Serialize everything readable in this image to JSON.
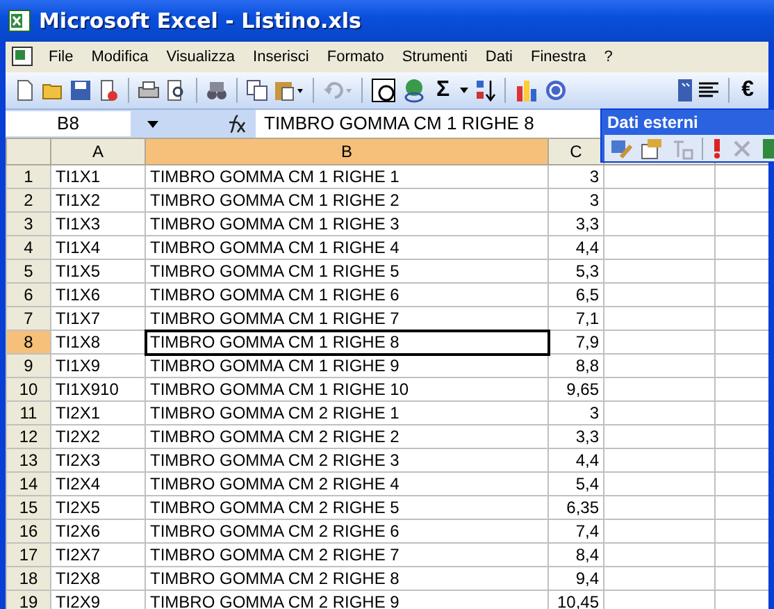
{
  "window": {
    "title": "Microsoft Excel - Listino.xls"
  },
  "menu": [
    "File",
    "Modifica",
    "Visualizza",
    "Inserisci",
    "Formato",
    "Strumenti",
    "Dati",
    "Finestra",
    "?"
  ],
  "toolbar": {
    "sum_symbol": "Σ",
    "euro_symbol": "€"
  },
  "formula_bar": {
    "name_box": "B8",
    "value": "TIMBRO GOMMA CM 1 RIGHE 8"
  },
  "floating_toolbar": {
    "title": "Dati esterni"
  },
  "columns": [
    {
      "label": "A",
      "selected": false
    },
    {
      "label": "B",
      "selected": true
    },
    {
      "label": "C",
      "selected": false
    }
  ],
  "rows": [
    {
      "num": "1",
      "a": "TI1X1",
      "b": "TIMBRO GOMMA CM 1 RIGHE 1",
      "c": "3",
      "selected": false
    },
    {
      "num": "2",
      "a": "TI1X2",
      "b": "TIMBRO GOMMA CM 1 RIGHE 2",
      "c": "3",
      "selected": false
    },
    {
      "num": "3",
      "a": "TI1X3",
      "b": "TIMBRO GOMMA CM 1 RIGHE 3",
      "c": "3,3",
      "selected": false
    },
    {
      "num": "4",
      "a": "TI1X4",
      "b": "TIMBRO GOMMA CM 1 RIGHE 4",
      "c": "4,4",
      "selected": false
    },
    {
      "num": "5",
      "a": "TI1X5",
      "b": "TIMBRO GOMMA CM 1 RIGHE 5",
      "c": "5,3",
      "selected": false
    },
    {
      "num": "6",
      "a": "TI1X6",
      "b": "TIMBRO GOMMA CM 1 RIGHE 6",
      "c": "6,5",
      "selected": false
    },
    {
      "num": "7",
      "a": "TI1X7",
      "b": "TIMBRO GOMMA CM 1 RIGHE 7",
      "c": "7,1",
      "selected": false
    },
    {
      "num": "8",
      "a": "TI1X8",
      "b": "TIMBRO GOMMA CM 1 RIGHE 8",
      "c": "7,9",
      "selected": true
    },
    {
      "num": "9",
      "a": "TI1X9",
      "b": "TIMBRO GOMMA CM 1 RIGHE 9",
      "c": "8,8",
      "selected": false
    },
    {
      "num": "10",
      "a": "TI1X910",
      "b": "TIMBRO GOMMA CM 1 RIGHE 10",
      "c": "9,65",
      "selected": false
    },
    {
      "num": "11",
      "a": "TI2X1",
      "b": "TIMBRO GOMMA CM 2 RIGHE 1",
      "c": "3",
      "selected": false
    },
    {
      "num": "12",
      "a": "TI2X2",
      "b": "TIMBRO GOMMA CM 2 RIGHE 2",
      "c": "3,3",
      "selected": false
    },
    {
      "num": "13",
      "a": "TI2X3",
      "b": "TIMBRO GOMMA CM 2 RIGHE 3",
      "c": "4,4",
      "selected": false
    },
    {
      "num": "14",
      "a": "TI2X4",
      "b": "TIMBRO GOMMA CM 2 RIGHE 4",
      "c": "5,4",
      "selected": false
    },
    {
      "num": "15",
      "a": "TI2X5",
      "b": "TIMBRO GOMMA CM 2 RIGHE 5",
      "c": "6,35",
      "selected": false
    },
    {
      "num": "16",
      "a": "TI2X6",
      "b": "TIMBRO GOMMA CM 2 RIGHE 6",
      "c": "7,4",
      "selected": false
    },
    {
      "num": "17",
      "a": "TI2X7",
      "b": "TIMBRO GOMMA CM 2 RIGHE 7",
      "c": "8,4",
      "selected": false
    },
    {
      "num": "18",
      "a": "TI2X8",
      "b": "TIMBRO GOMMA CM 2 RIGHE 8",
      "c": "9,4",
      "selected": false
    },
    {
      "num": "19",
      "a": "TI2X9",
      "b": "TIMBRO GOMMA CM 2 RIGHE 9",
      "c": "10,45",
      "selected": false
    }
  ]
}
